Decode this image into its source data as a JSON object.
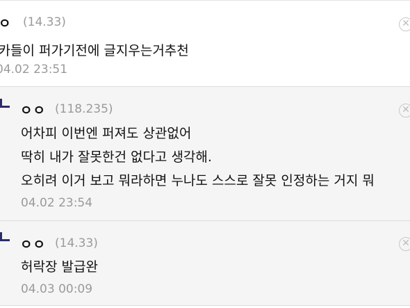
{
  "comments": [
    {
      "nick": "ㅇ",
      "ip": "(14.33)",
      "lines": [
        "네카들이 퍼가기전에 글지우는거추천"
      ],
      "date": "04.02 23:51"
    },
    {
      "nick": "ㅇㅇ",
      "ip": "(118.235)",
      "lines": [
        "어차피 이번엔 퍼져도 상관없어",
        "딱히 내가 잘못한건 없다고 생각해.",
        "오히려 이거 보고 뭐라하면 누나도 스스로 잘못 인정하는 거지 뭐"
      ],
      "date": "04.02 23:54"
    },
    {
      "nick": "ㅇㅇ",
      "ip": "(14.33)",
      "lines": [
        "허락장 발급완"
      ],
      "date": "04.03 00:09"
    }
  ],
  "icons": {
    "reply": "reply-arrow-icon",
    "delete": "delete-x-icon"
  },
  "colors": {
    "reply_bg": "#f5f5f5",
    "meta_gray": "#9a9a9a",
    "reply_mark": "#2c2c6a"
  }
}
